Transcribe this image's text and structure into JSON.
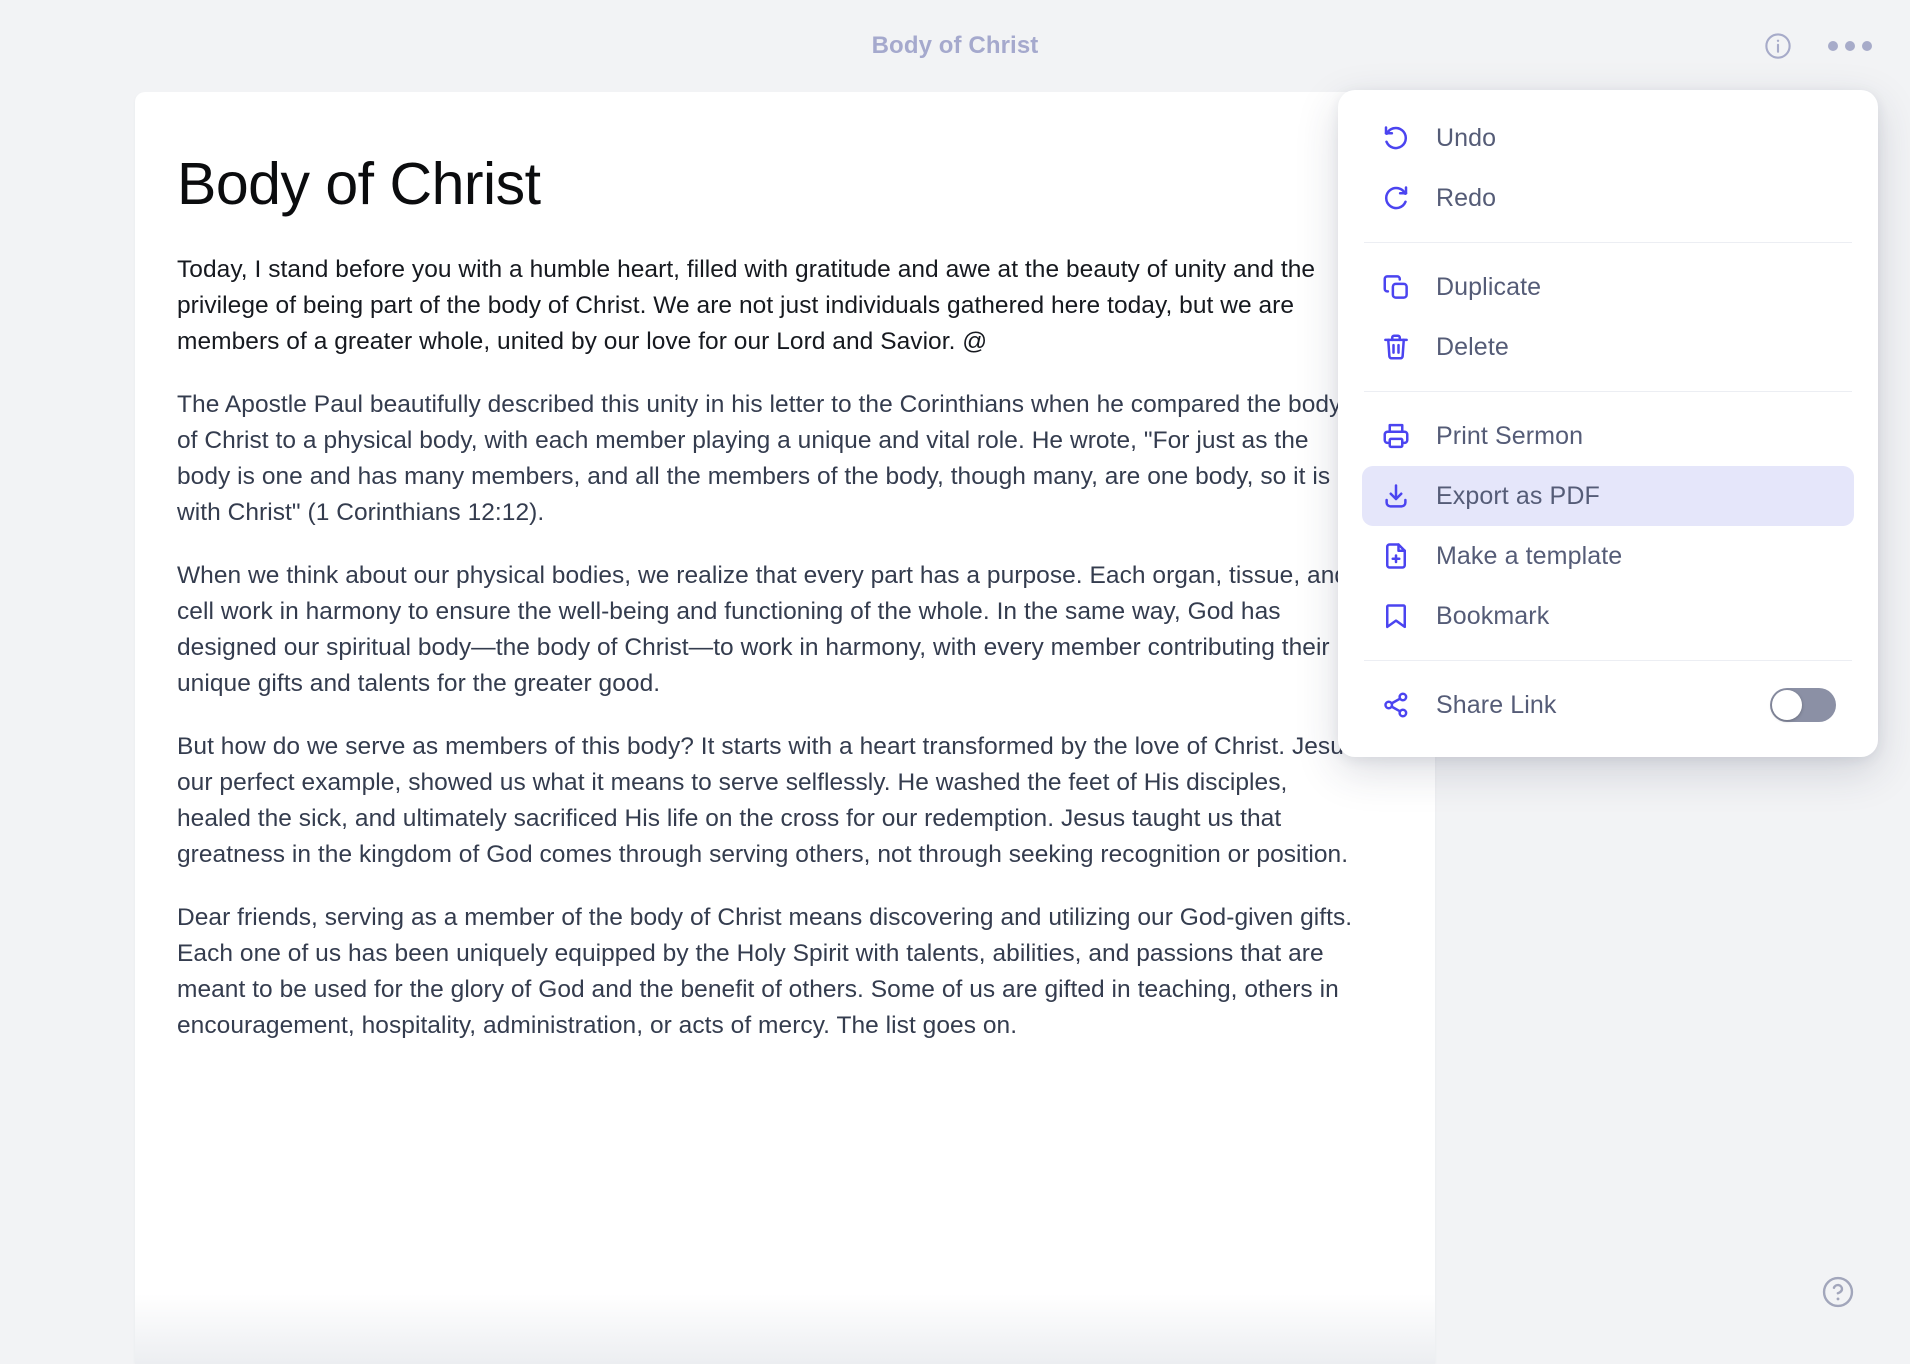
{
  "header": {
    "title": "Body of Christ",
    "info_icon": "info-circle-icon",
    "more_icon": "more-horizontal-icon"
  },
  "document": {
    "title": "Body of Christ",
    "paragraphs": [
      "Today, I stand before you with a humble heart, filled with gratitude and awe at the beauty of unity and the privilege of being part of the body of Christ. We are not just individuals gathered here today, but we are members of a greater whole, united by our love for our Lord and Savior. @",
      "The Apostle Paul beautifully described this unity in his letter to the Corinthians when he compared the body of Christ to a physical body, with each member playing a unique and vital role. He wrote, \"For just as the body is one and has many members, and all the members of the body, though many, are one body, so it is with Christ\" (1 Corinthians 12:12).",
      "When we think about our physical bodies, we realize that every part has a purpose. Each organ, tissue, and cell work in harmony to ensure the well-being and functioning of the whole. In the same way, God has designed our spiritual body—the body of Christ—to work in harmony, with every member contributing their unique gifts and talents for the greater good.",
      "But how do we serve as members of this body? It starts with a heart transformed by the love of Christ. Jesus, our perfect example, showed us what it means to serve selflessly. He washed the feet of His disciples, healed the sick, and ultimately sacrificed His life on the cross for our redemption. Jesus taught us that greatness in the kingdom of God comes through serving others, not through seeking recognition or position.",
      "Dear friends, serving as a member of the body of Christ means discovering and utilizing our God-given gifts. Each one of us has been uniquely equipped by the Holy Spirit with talents, abilities, and passions that are meant to be used for the glory of God and the benefit of others. Some of us are gifted in teaching, others in encouragement, hospitality, administration, or acts of mercy. The list goes on."
    ]
  },
  "menu": {
    "groups": [
      {
        "items": [
          {
            "label": "Undo",
            "icon": "undo-icon",
            "highlighted": false
          },
          {
            "label": "Redo",
            "icon": "redo-icon",
            "highlighted": false
          }
        ]
      },
      {
        "items": [
          {
            "label": "Duplicate",
            "icon": "duplicate-icon",
            "highlighted": false
          },
          {
            "label": "Delete",
            "icon": "trash-icon",
            "highlighted": false
          }
        ]
      },
      {
        "items": [
          {
            "label": "Print Sermon",
            "icon": "printer-icon",
            "highlighted": false
          },
          {
            "label": "Export as PDF",
            "icon": "download-icon",
            "highlighted": true
          },
          {
            "label": "Make a template",
            "icon": "file-plus-icon",
            "highlighted": false
          },
          {
            "label": "Bookmark",
            "icon": "bookmark-icon",
            "highlighted": false
          }
        ]
      },
      {
        "items": [
          {
            "label": "Share Link",
            "icon": "share-icon",
            "highlighted": false,
            "toggle": "off"
          }
        ]
      }
    ]
  },
  "help": {
    "icon": "help-circle-icon"
  },
  "colors": {
    "page_background": "#f2f3f5",
    "card_background": "#ffffff",
    "accent": "#4b44f0",
    "menu_label": "#555c77",
    "header_title": "#a5a9cd",
    "highlight_row": "#e5e6fa",
    "toggle_off_track": "#8b90a5",
    "body_text": "#343c4e"
  }
}
